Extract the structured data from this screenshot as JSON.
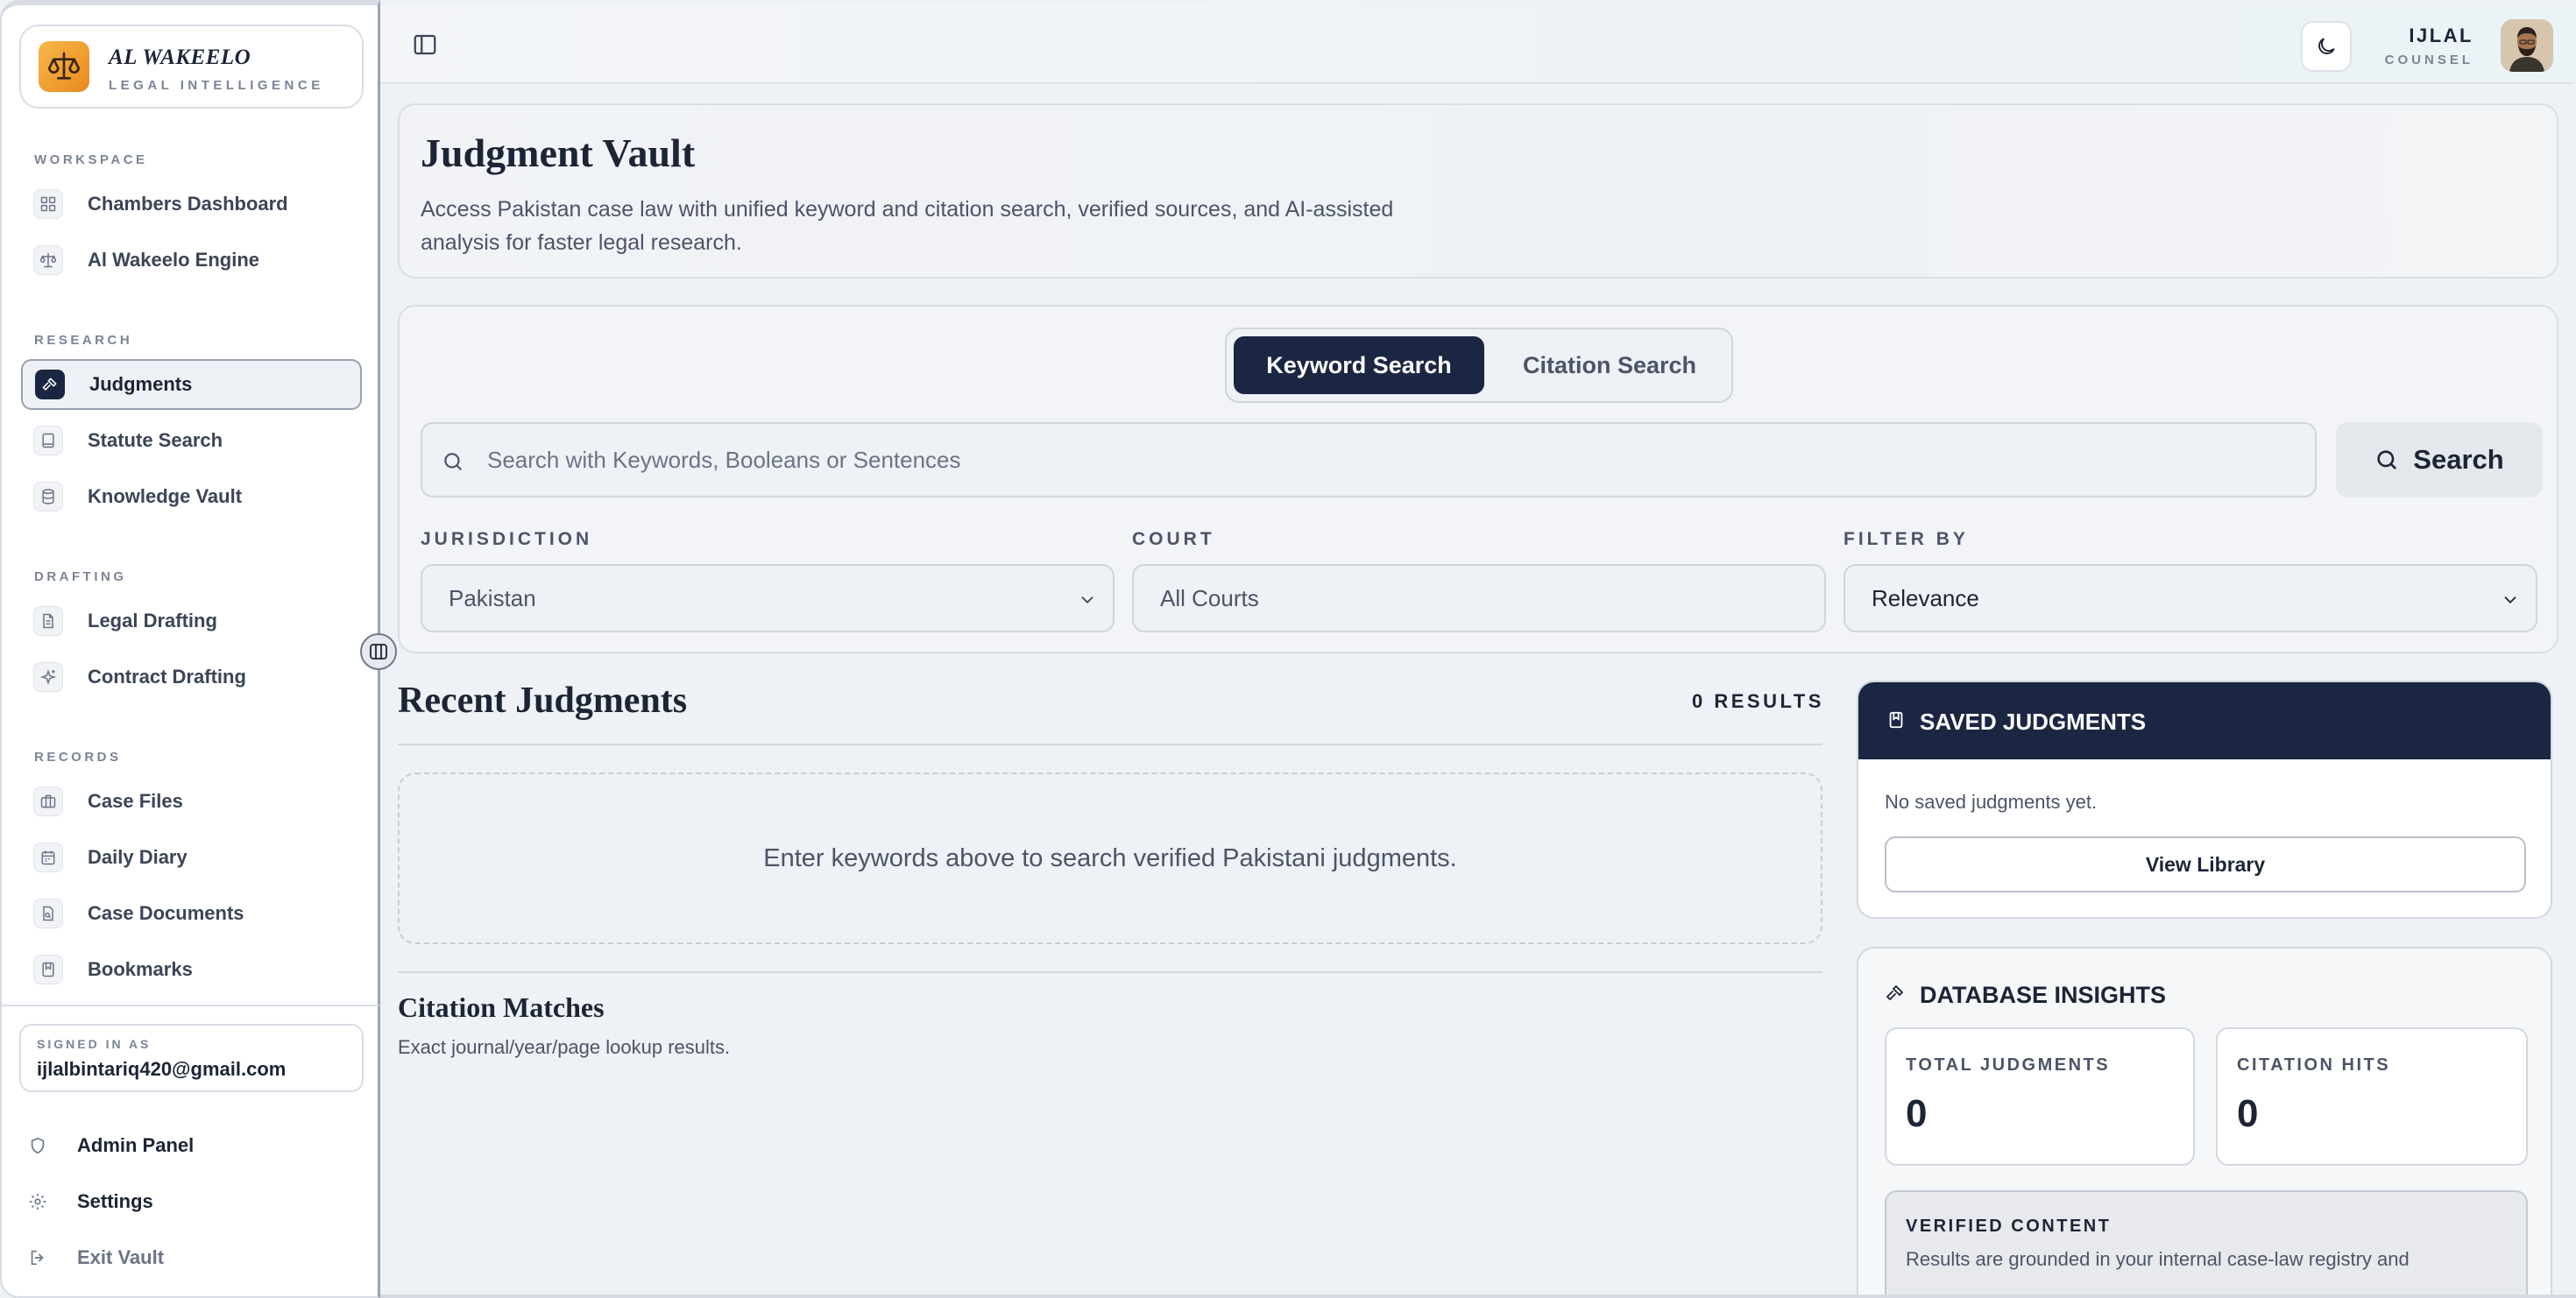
{
  "brand": {
    "name": "AL WAKEELO",
    "subtitle": "LEGAL INTELLIGENCE"
  },
  "sidebar": {
    "sections": [
      {
        "label": "WORKSPACE"
      },
      {
        "label": "RESEARCH"
      },
      {
        "label": "DRAFTING"
      },
      {
        "label": "RECORDS"
      }
    ],
    "items": [
      {
        "label": "Chambers Dashboard",
        "icon": "dashboard-icon"
      },
      {
        "label": "Al Wakeelo Engine",
        "icon": "scales-icon"
      },
      {
        "label": "Judgments",
        "icon": "gavel-icon",
        "active": true
      },
      {
        "label": "Statute Search",
        "icon": "book-icon"
      },
      {
        "label": "Knowledge Vault",
        "icon": "database-icon"
      },
      {
        "label": "Legal Drafting",
        "icon": "document-icon"
      },
      {
        "label": "Contract Drafting",
        "icon": "sparkle-icon"
      },
      {
        "label": "Case Files",
        "icon": "briefcase-icon"
      },
      {
        "label": "Daily Diary",
        "icon": "calendar-icon"
      },
      {
        "label": "Case Documents",
        "icon": "file-search-icon"
      },
      {
        "label": "Bookmarks",
        "icon": "bookmark-icon"
      }
    ],
    "signed_in": {
      "label": "SIGNED IN AS",
      "email": "ijlalbintariq420@gmail.com"
    },
    "footer": [
      {
        "label": "Admin Panel",
        "icon": "shield-icon"
      },
      {
        "label": "Settings",
        "icon": "gear-icon"
      },
      {
        "label": "Exit Vault",
        "icon": "logout-icon"
      }
    ]
  },
  "topbar": {
    "user_name": "IJLAL",
    "user_role": "COUNSEL"
  },
  "hero": {
    "title": "Judgment Vault",
    "description": "Access Pakistan case law with unified keyword and citation search, verified sources, and AI-assisted analysis for faster legal research."
  },
  "search": {
    "tabs": [
      {
        "label": "Keyword Search",
        "active": true
      },
      {
        "label": "Citation Search",
        "active": false
      }
    ],
    "placeholder": "Search with Keywords, Booleans or Sentences",
    "button_label": "Search",
    "filters": [
      {
        "label": "JURISDICTION",
        "value": "Pakistan"
      },
      {
        "label": "COURT",
        "value": "All Courts"
      },
      {
        "label": "FILTER BY",
        "value": "Relevance"
      }
    ]
  },
  "recent": {
    "title": "Recent Judgments",
    "count": "0 RESULTS",
    "empty_message": "Enter keywords above to search verified Pakistani judgments."
  },
  "citation": {
    "title": "Citation Matches",
    "subtitle": "Exact journal/year/page lookup results."
  },
  "saved": {
    "title": "SAVED JUDGMENTS",
    "empty": "No saved judgments yet.",
    "button_label": "View Library"
  },
  "insights": {
    "title": "DATABASE INSIGHTS",
    "stats": [
      {
        "label": "TOTAL JUDGMENTS",
        "value": "0"
      },
      {
        "label": "CITATION HITS",
        "value": "0"
      }
    ],
    "verified_label": "VERIFIED CONTENT",
    "verified_text": "Results are grounded in your internal case-law registry and"
  },
  "colors": {
    "navy": "#1b2643",
    "accent_orange": "#e8891e",
    "background": "#eef1f5"
  }
}
